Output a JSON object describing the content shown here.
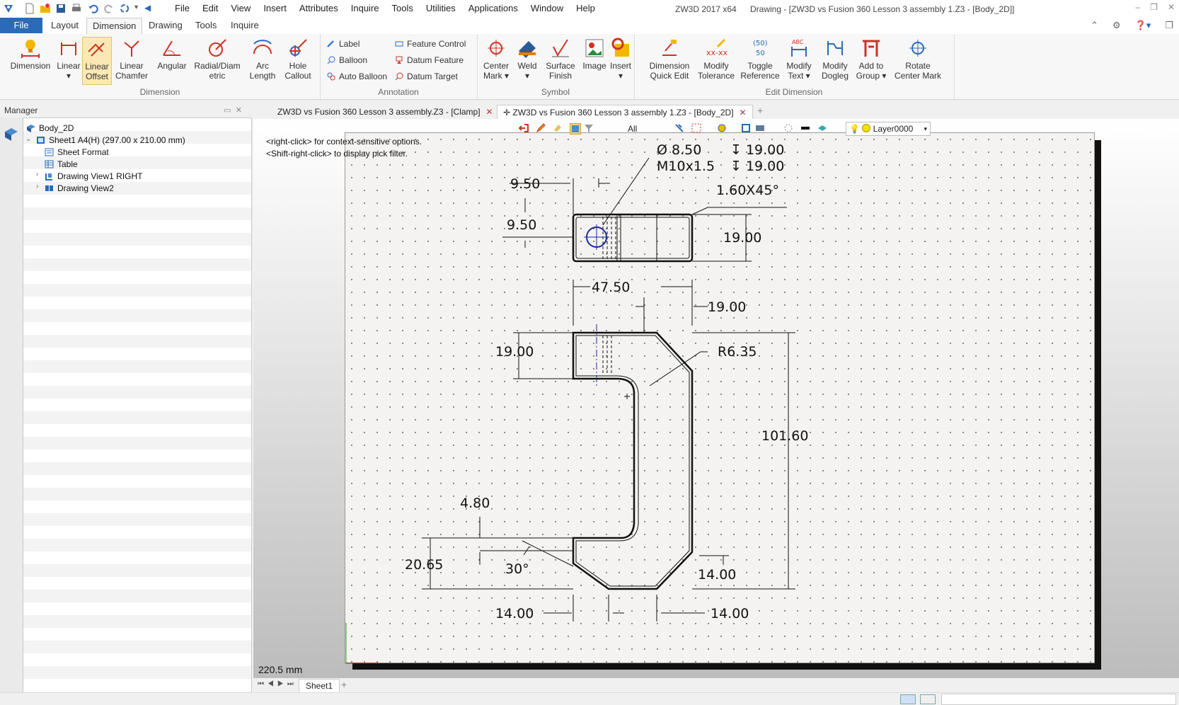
{
  "app": {
    "name": "ZW3D 2017  x64",
    "document_title": "Drawing - [ZW3D vs Fusion 360 Lesson 3 assembly 1.Z3 - [Body_2D]]"
  },
  "menu": [
    "File",
    "Edit",
    "View",
    "Insert",
    "Attributes",
    "Inquire",
    "Tools",
    "Utilities",
    "Applications",
    "Window",
    "Help"
  ],
  "ribbon_tabs": {
    "file": "File",
    "tabs": [
      "Layout",
      "Dimension",
      "Drawing",
      "Tools",
      "Inquire"
    ],
    "active": "Dimension"
  },
  "ribbon": {
    "dimension_group": {
      "label": "Dimension",
      "buttons": [
        {
          "l1": "Dimension",
          "l2": "",
          "icon": "dimension-icon"
        },
        {
          "l1": "Linear",
          "l2": "▾",
          "icon": "linear-icon"
        },
        {
          "l1": "Linear",
          "l2": "Offset",
          "icon": "linear-offset-icon"
        },
        {
          "l1": "Linear",
          "l2": "Chamfer",
          "icon": "linear-chamfer-icon"
        },
        {
          "l1": "Angular",
          "l2": "",
          "icon": "angular-icon"
        },
        {
          "l1": "Radial/Diam",
          "l2": "etric",
          "icon": "radial-icon"
        },
        {
          "l1": "Arc",
          "l2": "Length",
          "icon": "arc-length-icon"
        },
        {
          "l1": "Hole",
          "l2": "Callout",
          "icon": "hole-callout-icon"
        }
      ]
    },
    "annotation_group": {
      "label": "Annotation",
      "items": [
        "Label",
        "Balloon",
        "Auto Balloon",
        "Feature Control",
        "Datum Feature",
        "Datum Target"
      ]
    },
    "symbol_group": {
      "label": "Symbol",
      "buttons": [
        {
          "l1": "Center",
          "l2": "Mark ▾"
        },
        {
          "l1": "Weld",
          "l2": "▾"
        },
        {
          "l1": "Surface",
          "l2": "Finish"
        },
        {
          "l1": "Image",
          "l2": ""
        },
        {
          "l1": "Insert",
          "l2": "▾"
        }
      ]
    },
    "edit_group": {
      "label": "Edit Dimension",
      "buttons": [
        {
          "l1": "Dimension",
          "l2": "Quick Edit"
        },
        {
          "l1": "Modify",
          "l2": "Tolerance"
        },
        {
          "l1": "Toggle",
          "l2": "Reference"
        },
        {
          "l1": "Modify",
          "l2": "Text ▾"
        },
        {
          "l1": "Modify",
          "l2": "Dogleg"
        },
        {
          "l1": "Add to",
          "l2": "Group ▾"
        },
        {
          "l1": "Rotate",
          "l2": "Center Mark"
        }
      ]
    }
  },
  "manager": {
    "title": "Manager",
    "tree": [
      {
        "label": "Body_2D",
        "level": 0,
        "toggle": ""
      },
      {
        "label": "Sheet1 A4(H) (297.00 x 210.00 mm)",
        "level": 1,
        "toggle": "⌄"
      },
      {
        "label": "Sheet Format",
        "level": 2,
        "toggle": ""
      },
      {
        "label": "Table",
        "level": 2,
        "toggle": ""
      },
      {
        "label": "Drawing View1 RIGHT",
        "level": 2,
        "toggle": "›"
      },
      {
        "label": "Drawing View2",
        "level": 2,
        "toggle": "›"
      }
    ]
  },
  "doc_tabs": [
    {
      "label": "ZW3D vs Fusion 360 Lesson 3 assembly.Z3 - [Clamp]",
      "active": false
    },
    {
      "label": "ZW3D vs Fusion 360 Lesson 3 assembly 1.Z3 - [Body_2D]",
      "active": true
    }
  ],
  "view_toolbar": {
    "filter": "All",
    "layer": "Layer0000"
  },
  "canvas": {
    "hint1": "<right-click> for context-sensitive options.",
    "hint2": "<Shift-right-click> to display pick filter.",
    "distance": "220.5 mm"
  },
  "dimensions": {
    "hole_dia": "Ø 8.50",
    "hole_depth": "↧ 19.00",
    "thread": "M10x1.5",
    "thread_depth": "↧ 19.00",
    "top_left": "9.50",
    "top_left2": "9.50",
    "chamfer": "1.60X45°",
    "height_top": "19.00",
    "width_total": "47.50",
    "width_right": "19.00",
    "upper_arm": "19.00",
    "radius": "R6.35",
    "height_total": "101.60",
    "lower_small": "4.80",
    "lower_height": "20.65",
    "angle": "30°",
    "right_lower": "14.00",
    "bottom_left": "14.00",
    "bottom_right": "14.00"
  },
  "sheetbar": {
    "tab": "Sheet1"
  }
}
